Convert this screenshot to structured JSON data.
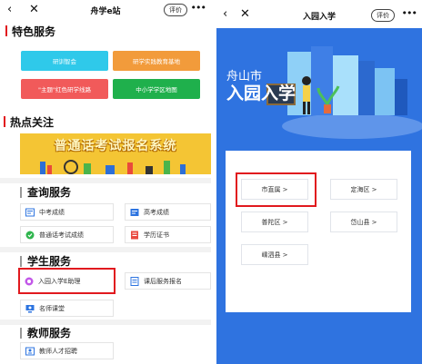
{
  "left": {
    "nav": {
      "back": "‹",
      "close": "✕",
      "title": "舟学e站",
      "rate": "评价",
      "more": "•••"
    },
    "featured": {
      "title": "特色服务",
      "tiles": [
        {
          "label": "研训智会",
          "color": "#2fc9ea"
        },
        {
          "label": "研学实践教育基地",
          "color": "#f29b3b"
        },
        {
          "label": "\"主题\"红色研学线路",
          "color": "#f15a5a"
        },
        {
          "label": "中小学学区地图",
          "color": "#1fb04c"
        }
      ]
    },
    "hot": {
      "title": "热点关注",
      "banner": "普通话考试报名系统"
    },
    "query": {
      "title": "查询服务",
      "items": [
        {
          "label": "中考成绩",
          "icon": "score-icon"
        },
        {
          "label": "高考成绩",
          "icon": "score-icon"
        },
        {
          "label": "普通话考试成绩",
          "icon": "mandarin-icon"
        },
        {
          "label": "学历证书",
          "icon": "certificate-icon"
        }
      ]
    },
    "student": {
      "title": "学生服务",
      "items": [
        {
          "label": "入园入学E助理",
          "icon": "assistant-icon"
        },
        {
          "label": "课后服务报名",
          "icon": "afterschool-icon"
        },
        {
          "label": "名师课堂",
          "icon": "classroom-icon"
        }
      ]
    },
    "teacher": {
      "title": "教师服务",
      "items": [
        {
          "label": "教师人才招聘",
          "icon": "recruit-icon"
        }
      ]
    }
  },
  "right": {
    "nav": {
      "back": "‹",
      "close": "✕",
      "title": "入园入学",
      "rate": "评价",
      "more": "•••"
    },
    "hero": {
      "city": "舟山市",
      "headline": "入园入学"
    },
    "districts": [
      {
        "label": "市直属 >"
      },
      {
        "label": "定海区 >"
      },
      {
        "label": "普陀区 >"
      },
      {
        "label": "岱山县 >"
      },
      {
        "label": "嵊泗县 >"
      }
    ]
  },
  "colors": {
    "accent_bar": "#e1191e",
    "right_bg": "#2f73e0",
    "highlight": "#e1191e"
  }
}
